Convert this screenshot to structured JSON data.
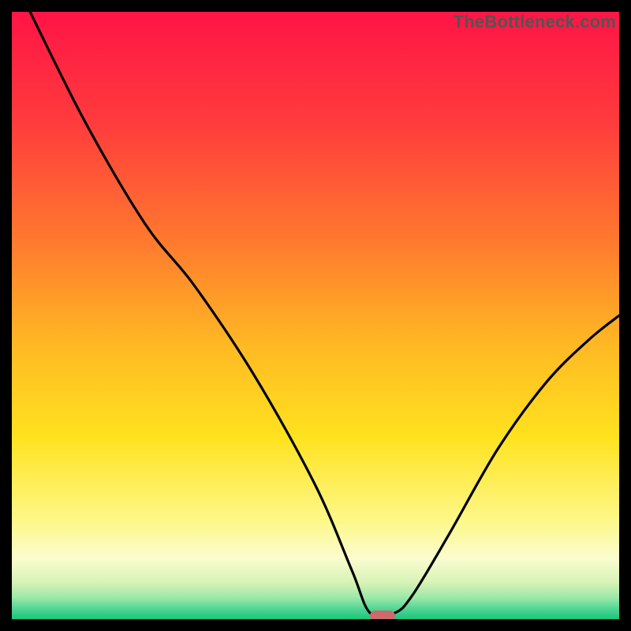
{
  "watermark": "TheBottleneck.com",
  "chart_data": {
    "type": "line",
    "title": "",
    "xlabel": "",
    "ylabel": "",
    "xlim": [
      0,
      100
    ],
    "ylim": [
      0,
      100
    ],
    "legend": false,
    "grid": false,
    "gradient_stops": [
      {
        "offset": 0.0,
        "color": "#ff1446"
      },
      {
        "offset": 0.18,
        "color": "#ff3b3d"
      },
      {
        "offset": 0.38,
        "color": "#ff7a2e"
      },
      {
        "offset": 0.55,
        "color": "#ffb924"
      },
      {
        "offset": 0.7,
        "color": "#ffe21e"
      },
      {
        "offset": 0.84,
        "color": "#fdf88a"
      },
      {
        "offset": 0.9,
        "color": "#fbfccf"
      },
      {
        "offset": 0.94,
        "color": "#d6f3b6"
      },
      {
        "offset": 0.965,
        "color": "#9ae8a8"
      },
      {
        "offset": 0.985,
        "color": "#4ad391"
      },
      {
        "offset": 1.0,
        "color": "#18c678"
      }
    ],
    "series": [
      {
        "name": "bottleneck-curve",
        "color": "#000000",
        "points": [
          {
            "x": 3.0,
            "y": 100.0
          },
          {
            "x": 12.0,
            "y": 82.0
          },
          {
            "x": 22.0,
            "y": 65.0
          },
          {
            "x": 30.0,
            "y": 55.0
          },
          {
            "x": 40.0,
            "y": 40.0
          },
          {
            "x": 50.0,
            "y": 22.0
          },
          {
            "x": 56.0,
            "y": 8.0
          },
          {
            "x": 59.0,
            "y": 1.0
          },
          {
            "x": 63.0,
            "y": 1.0
          },
          {
            "x": 66.0,
            "y": 4.0
          },
          {
            "x": 72.0,
            "y": 14.0
          },
          {
            "x": 80.0,
            "y": 28.0
          },
          {
            "x": 88.0,
            "y": 39.0
          },
          {
            "x": 95.0,
            "y": 46.0
          },
          {
            "x": 100.0,
            "y": 50.0
          }
        ]
      }
    ],
    "marker": {
      "x": 61.0,
      "y": 0.5,
      "color": "#cc6a6e"
    }
  }
}
